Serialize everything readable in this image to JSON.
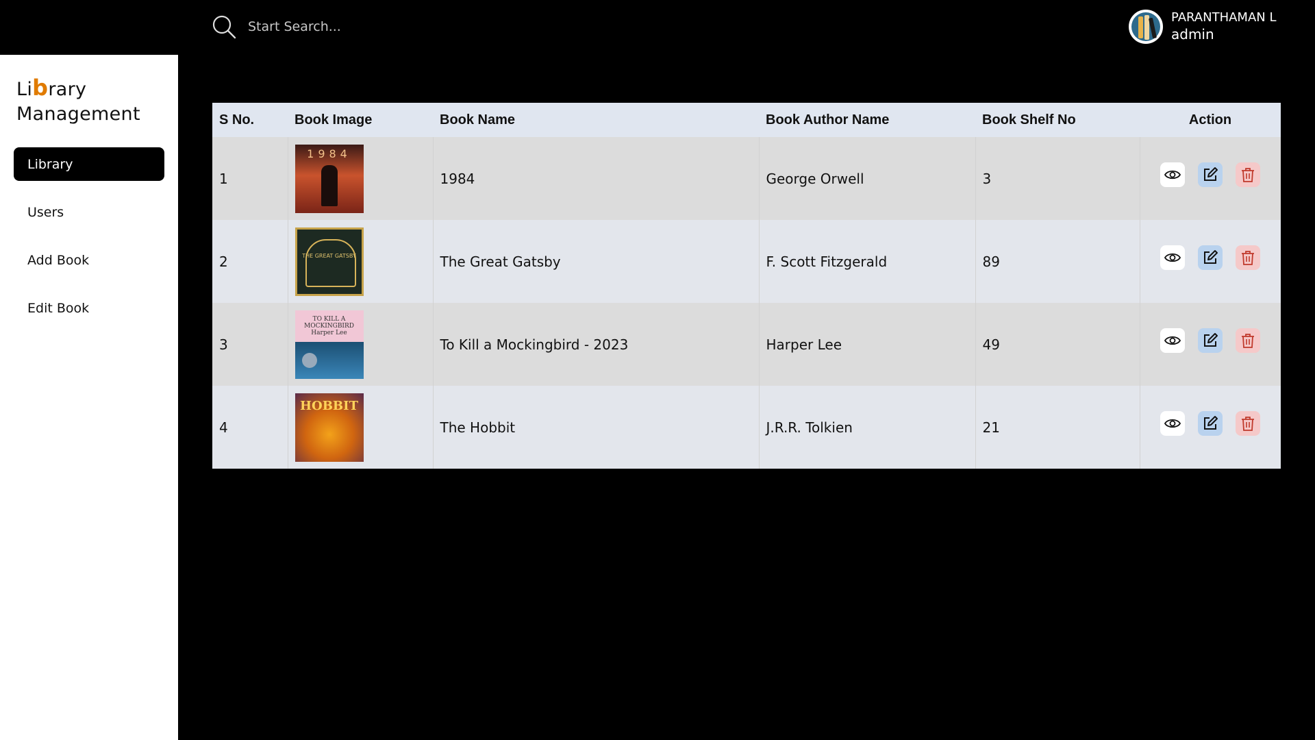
{
  "search": {
    "placeholder": "Start Search..."
  },
  "user": {
    "name": "PARANTHAMAN L",
    "role": "admin"
  },
  "logo": {
    "prefix": "Li",
    "accent": "b",
    "suffix": "rary",
    "line2": "Management"
  },
  "sidebar": {
    "items": [
      {
        "label": "Library",
        "active": true
      },
      {
        "label": "Users"
      },
      {
        "label": "Add Book"
      },
      {
        "label": "Edit Book"
      }
    ]
  },
  "table": {
    "headers": [
      "S No.",
      "Book Image",
      "Book Name",
      "Book Author Name",
      "Book Shelf No",
      "Action"
    ],
    "rows": [
      {
        "sno": "1",
        "name": "1984",
        "author": "George Orwell",
        "shelf": "3",
        "cover_text": "1984"
      },
      {
        "sno": "2",
        "name": "The Great Gatsby",
        "author": "F. Scott Fitzgerald",
        "shelf": "89",
        "cover_text": "THE GREAT GATSBY"
      },
      {
        "sno": "3",
        "name": "To Kill a Mockingbird - 2023",
        "author": "Harper Lee",
        "shelf": "49",
        "cover_text": "TO KILL A MOCKINGBIRD Harper Lee"
      },
      {
        "sno": "4",
        "name": "The Hobbit",
        "author": "J.R.R. Tolkien",
        "shelf": "21",
        "cover_text": "HOBBIT"
      }
    ]
  },
  "icons": {
    "search": "search-icon",
    "view": "eye-icon",
    "edit": "edit-icon",
    "delete": "trash-icon"
  },
  "colors": {
    "accent": "#e07b00",
    "header_bg": "#e0e6f0",
    "edit_bg": "#b9d2ee",
    "delete_bg": "#f5c9c9"
  }
}
